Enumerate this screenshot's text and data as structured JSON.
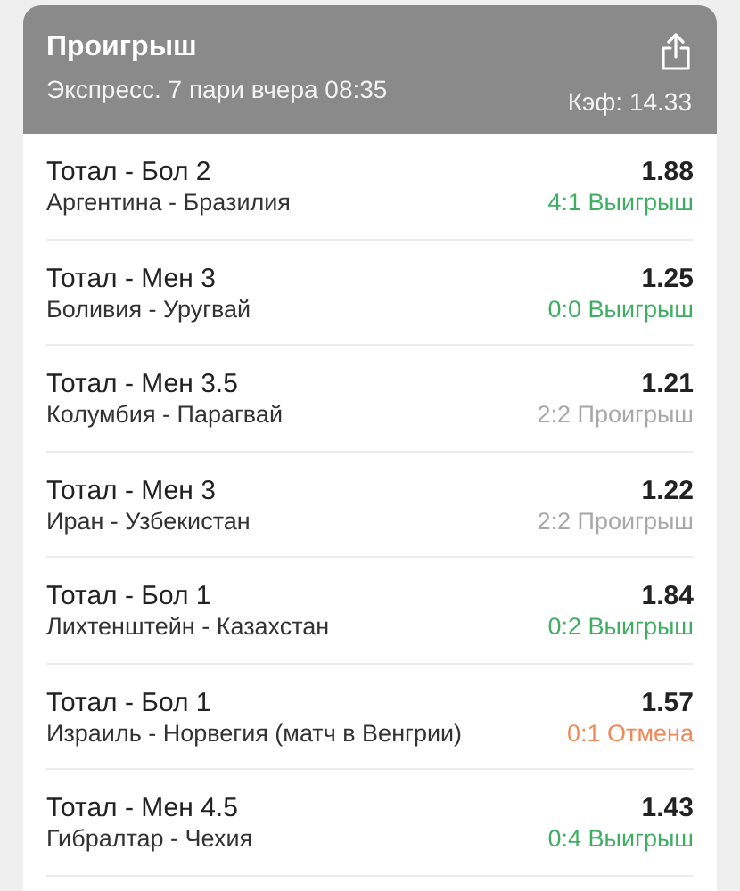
{
  "header": {
    "title": "Проигрыш",
    "subtitle": "Экспресс. 7 пари вчера 08:35",
    "odds": "Кэф: 14.33"
  },
  "bets": [
    {
      "market": "Тотал - Бол 2",
      "match": "Аргентина - Бразилия",
      "odds": "1.88",
      "result": "4:1 Выигрыш",
      "color": "#3fae62"
    },
    {
      "market": "Тотал - Мен 3",
      "match": "Боливия - Уругвай",
      "odds": "1.25",
      "result": "0:0 Выигрыш",
      "color": "#3fae62"
    },
    {
      "market": "Тотал - Мен 3.5",
      "match": "Колумбия - Парагвай",
      "odds": "1.21",
      "result": "2:2 Проигрыш",
      "color": "#a8a8a8"
    },
    {
      "market": "Тотал - Мен 3",
      "match": "Иран - Узбекистан",
      "odds": "1.22",
      "result": "2:2 Проигрыш",
      "color": "#a8a8a8"
    },
    {
      "market": "Тотал - Бол 1",
      "match": "Лихтенштейн - Казахстан",
      "odds": "1.84",
      "result": "0:2 Выигрыш",
      "color": "#3fae62"
    },
    {
      "market": "Тотал - Бол 1",
      "match": "Израиль - Норвегия (матч в Венгрии)",
      "odds": "1.57",
      "result": "0:1 Отмена",
      "color": "#ee8a5a"
    },
    {
      "market": "Тотал - Мен 4.5",
      "match": "Гибралтар - Чехия",
      "odds": "1.43",
      "result": "0:4 Выигрыш",
      "color": "#3fae62"
    }
  ]
}
